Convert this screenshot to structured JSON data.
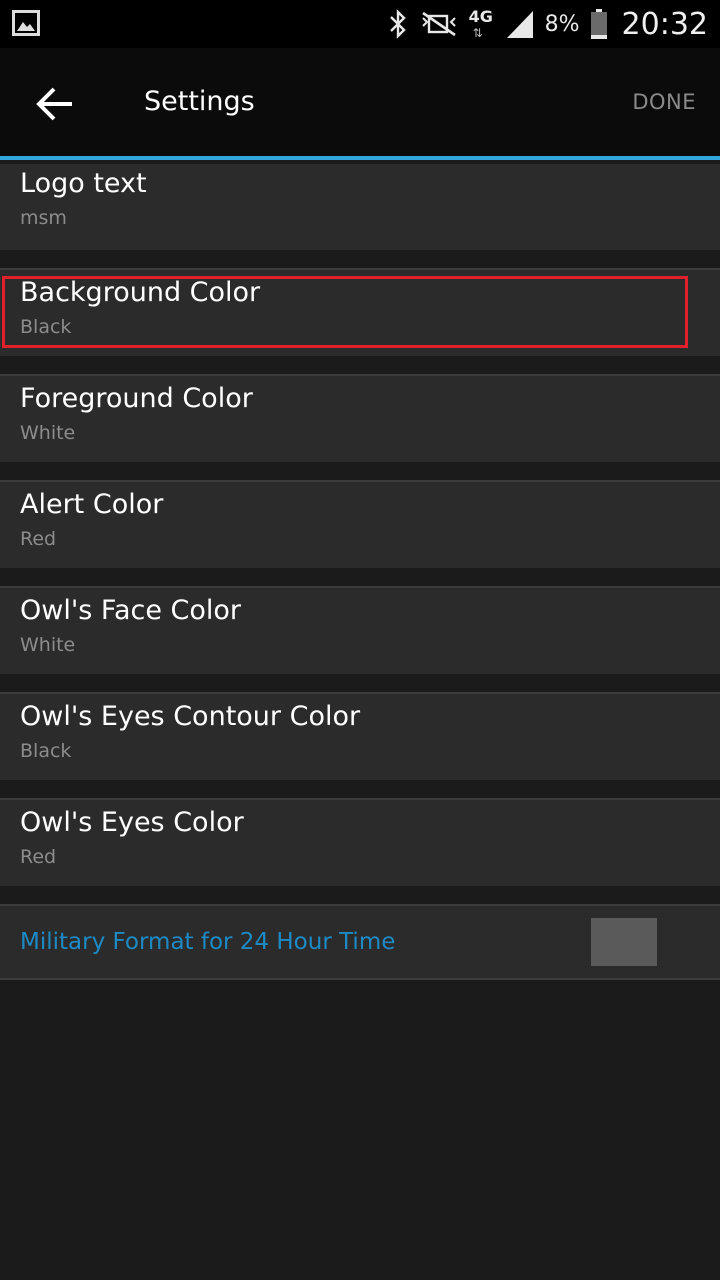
{
  "status_bar": {
    "network_label": "4G",
    "network_arrows": "⇅",
    "battery_percent": "8%",
    "clock": "20:32",
    "icons": [
      "gallery-icon",
      "bluetooth-icon",
      "mute-icon",
      "signal-icon",
      "battery-icon"
    ]
  },
  "action_bar": {
    "title": "Settings",
    "done_label": "DONE",
    "accent_color": "#33a6e0"
  },
  "settings": {
    "items": [
      {
        "title": "Logo text",
        "value": "msm"
      },
      {
        "title": "Background Color",
        "value": "Black"
      },
      {
        "title": "Foreground Color",
        "value": "White"
      },
      {
        "title": "Alert Color",
        "value": "Red"
      },
      {
        "title": "Owl's Face Color",
        "value": "White"
      },
      {
        "title": "Owl's Eyes Contour Color",
        "value": "Black"
      },
      {
        "title": "Owl's Eyes Color",
        "value": "Red"
      }
    ],
    "toggle": {
      "label": "Military Format for 24 Hour Time",
      "label_color": "#1d8ac5",
      "state": "off"
    }
  },
  "highlight_color": "#e0202a"
}
